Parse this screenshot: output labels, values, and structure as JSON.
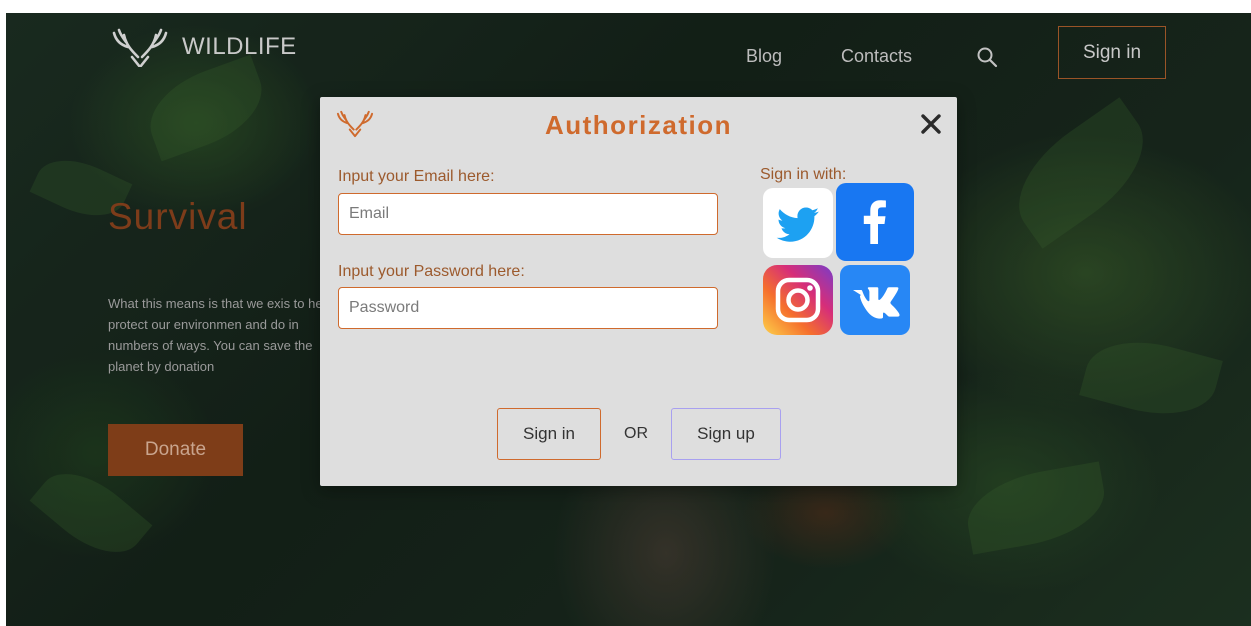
{
  "header": {
    "logo_text": "WILDLIFE",
    "nav": {
      "blog": "Blog",
      "contacts": "Contacts"
    },
    "signin_label": "Sign in"
  },
  "hero": {
    "title": "Survival",
    "text": "What this means is that we exis to help protect our environmen and do in numbers of ways. You can save the planet by donation",
    "donate_label": "Donate"
  },
  "modal": {
    "title": "Authorization",
    "email_label": "Input your Email here:",
    "email_placeholder": "Email",
    "password_label": "Input your Password here:",
    "password_placeholder": "Password",
    "social_label": "Sign in with:",
    "signin_label": "Sign in",
    "or_text": "OR",
    "signup_label": "Sign up"
  },
  "colors": {
    "accent": "#cf6a2d",
    "hero_title": "#7d3c1a",
    "donate_bg": "#7e3d18",
    "modal_bg": "#dedede",
    "signup_border": "#a8a0f0",
    "facebook": "#1877f2",
    "twitter": "#1da1f2",
    "vk": "#2787f5"
  },
  "icons": [
    "antlers-logo-icon",
    "search-icon",
    "close-icon",
    "twitter-icon",
    "facebook-icon",
    "instagram-icon",
    "vk-icon"
  ]
}
